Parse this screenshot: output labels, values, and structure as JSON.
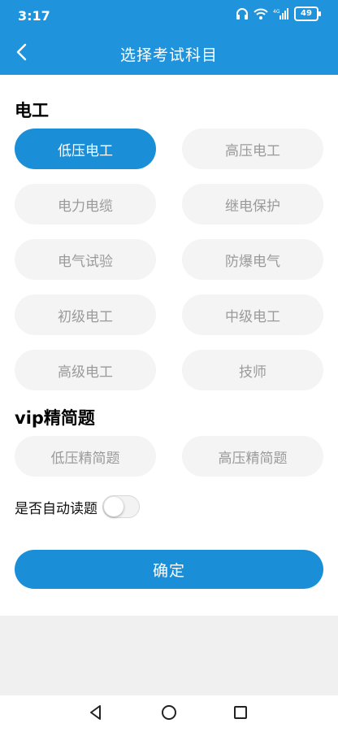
{
  "status_bar": {
    "time": "3:17",
    "battery": "49",
    "icons": [
      "headphones-icon",
      "wifi-icon",
      "signal-4g-icon",
      "battery-icon"
    ]
  },
  "header": {
    "title": "选择考试科目",
    "back_icon": "chevron-left-icon"
  },
  "sections": {
    "electrician": {
      "title": "电工",
      "options": [
        {
          "label": "低压电工",
          "selected": true
        },
        {
          "label": "高压电工",
          "selected": false
        },
        {
          "label": "电力电缆",
          "selected": false
        },
        {
          "label": "继电保护",
          "selected": false
        },
        {
          "label": "电气试验",
          "selected": false
        },
        {
          "label": "防爆电气",
          "selected": false
        },
        {
          "label": "初级电工",
          "selected": false
        },
        {
          "label": "中级电工",
          "selected": false
        },
        {
          "label": "高级电工",
          "selected": false
        },
        {
          "label": "技师",
          "selected": false
        }
      ]
    },
    "vip": {
      "title": "vip精简题",
      "options": [
        {
          "label": "低压精简题",
          "selected": false
        },
        {
          "label": "高压精简题",
          "selected": false
        }
      ]
    }
  },
  "auto_read": {
    "label": "是否自动读题",
    "enabled": false
  },
  "confirm_label": "确定",
  "nav": {
    "icons": [
      "back-triangle-icon",
      "home-circle-icon",
      "recents-square-icon"
    ]
  },
  "colors": {
    "accent": "#1a8fd8",
    "header": "#1f93db",
    "pill_bg": "#f4f4f4",
    "pill_text": "#9a9a9a"
  }
}
